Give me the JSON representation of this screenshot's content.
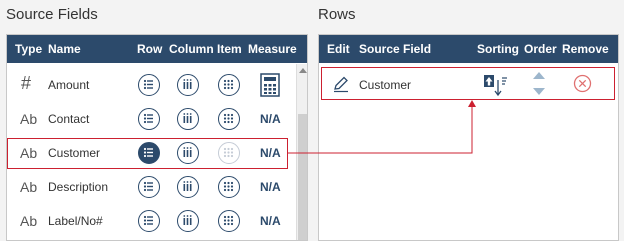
{
  "source_fields": {
    "title": "Source Fields",
    "headers": {
      "type": "Type",
      "name": "Name",
      "row": "Row",
      "column": "Column",
      "item": "Item",
      "measure": "Measure"
    },
    "rows": [
      {
        "type": "#",
        "name": "Amount",
        "row_state": "outline",
        "column_state": "outline",
        "item_state": "outline",
        "measure": "calculator-icon"
      },
      {
        "type": "Ab",
        "name": "Contact",
        "row_state": "outline",
        "column_state": "outline",
        "item_state": "outline",
        "measure": "N/A"
      },
      {
        "type": "Ab",
        "name": "Customer",
        "row_state": "selected",
        "column_state": "outline",
        "item_state": "disabled",
        "measure": "N/A"
      },
      {
        "type": "Ab",
        "name": "Description",
        "row_state": "outline",
        "column_state": "outline",
        "item_state": "outline",
        "measure": "N/A"
      },
      {
        "type": "Ab",
        "name": "Label/No#",
        "row_state": "outline",
        "column_state": "outline",
        "item_state": "outline",
        "measure": "N/A"
      }
    ]
  },
  "rows_panel": {
    "title": "Rows",
    "headers": {
      "edit": "Edit",
      "source_field": "Source Field",
      "sorting": "Sorting",
      "order": "Order",
      "remove": "Remove"
    },
    "rows": [
      {
        "source_field": "Customer",
        "sorting": "ascending-icon",
        "order": "up-down-arrows",
        "remove": "remove-circle-icon"
      }
    ]
  },
  "colors": {
    "header_bg": "#2c4a6b",
    "accent": "#2c4a6b",
    "highlight": "#cc2030",
    "remove": "#e07070",
    "order_arrow": "#9db6cc"
  }
}
